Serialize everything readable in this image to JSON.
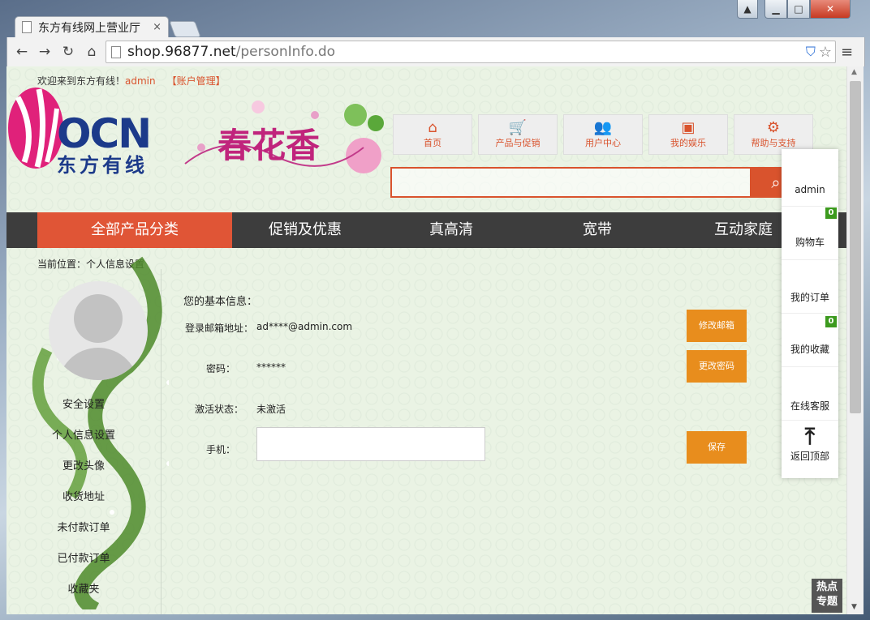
{
  "browser": {
    "tab_title": "东方有线网上营业厅",
    "tab_close": "×",
    "url_host": "shop.96877.net",
    "url_path": "/personInfo.do",
    "nav": {
      "back": "←",
      "forward": "→",
      "reload": "↻",
      "home": "⌂"
    },
    "menu": "≡",
    "window": {
      "user": "▲",
      "min": "▁",
      "max": "□",
      "close": "✕"
    }
  },
  "header": {
    "welcome": "欢迎来到东方有线！",
    "username": "admin",
    "account_link": "【账户管理】",
    "logo_main": "OCN",
    "logo_sub": "东方有线",
    "banner_text": "春花香",
    "topnav": [
      {
        "label": "首页",
        "icon": "home-icon",
        "glyph": "⌂"
      },
      {
        "label": "产品与促销",
        "icon": "cart-icon",
        "glyph": "🛒"
      },
      {
        "label": "用户中心",
        "icon": "users-icon",
        "glyph": "👥"
      },
      {
        "label": "我的娱乐",
        "icon": "film-icon",
        "glyph": "▣"
      },
      {
        "label": "帮助与支持",
        "icon": "gear-icon",
        "glyph": "⚙"
      }
    ],
    "search_placeholder": "",
    "search_icon": "🔍"
  },
  "categories": [
    {
      "label": "全部产品分类",
      "active": true
    },
    {
      "label": "促销及优惠",
      "active": false
    },
    {
      "label": "真高清",
      "active": false
    },
    {
      "label": "宽带",
      "active": false
    },
    {
      "label": "互动家庭",
      "active": false
    }
  ],
  "breadcrumb": "当前位置：个人信息设置",
  "sidebar": {
    "items": [
      "安全设置",
      "个人信息设置",
      "更改头像",
      "收货地址",
      "未付款订单",
      "已付款订单",
      "收藏夹"
    ]
  },
  "profile": {
    "section_title": "您的基本信息：",
    "email_label": "登录邮箱地址：",
    "email_value": "ad****@admin.com",
    "email_button": "修改邮箱",
    "password_label": "密码：",
    "password_value": "******",
    "password_button": "更改密码",
    "status_label": "激活状态：",
    "status_value": "未激活",
    "phone_label": "手机：",
    "phone_value": "",
    "save_button": "保存"
  },
  "float_panel": {
    "user": "admin",
    "cart": "购物车",
    "cart_count": "0",
    "orders": "我的订单",
    "favorites": "我的收藏",
    "favorites_count": "0",
    "service": "在线客服",
    "top": "返回顶部"
  },
  "hot_topic": {
    "line1": "热点",
    "line2": "专题"
  },
  "colors": {
    "accent": "#d9532d",
    "button": "#e88d1d",
    "catbar": "#3d3d3d",
    "badge": "#3c9a1e"
  }
}
